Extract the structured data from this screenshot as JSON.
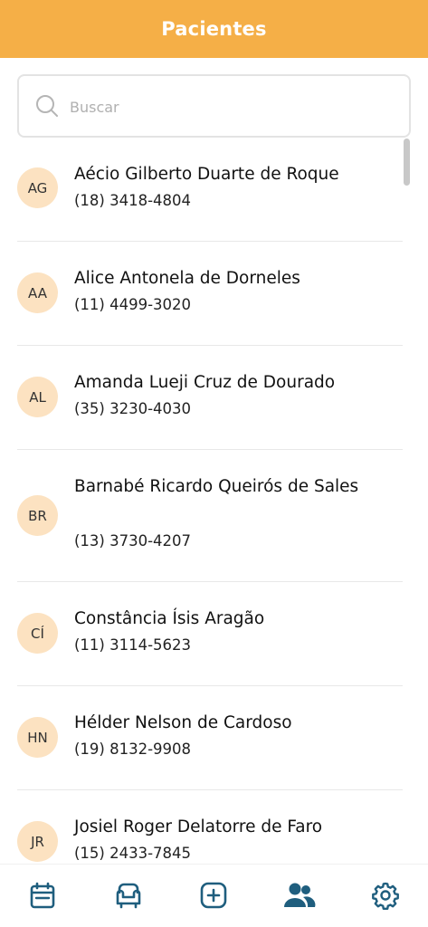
{
  "header": {
    "title": "Pacientes"
  },
  "search": {
    "placeholder": "Buscar"
  },
  "patients": [
    {
      "initials": "AG",
      "name": "Aécio Gilberto Duarte de Roque",
      "phone": "(18) 3418-4804"
    },
    {
      "initials": "AA",
      "name": "Alice Antonela de Dorneles",
      "phone": "(11) 4499-3020"
    },
    {
      "initials": "AL",
      "name": "Amanda Lueji Cruz de Dourado",
      "phone": "(35) 3230-4030"
    },
    {
      "initials": "BR",
      "name": "Barnabé Ricardo Queirós de Sales",
      "phone": "(13) 3730-4207"
    },
    {
      "initials": "CÍ",
      "name": "Constância Ísis Aragão",
      "phone": "(11) 3114-5623"
    },
    {
      "initials": "HN",
      "name": "Hélder Nelson de Cardoso",
      "phone": "(19) 8132-9908"
    },
    {
      "initials": "JR",
      "name": "Josiel Roger Delatorre de Faro",
      "phone": "(15) 2433-7845"
    }
  ],
  "bottom_nav": {
    "items": [
      {
        "icon": "calendar-icon",
        "active": false
      },
      {
        "icon": "armchair-icon",
        "active": false
      },
      {
        "icon": "add-square-icon",
        "active": false
      },
      {
        "icon": "users-icon",
        "active": true
      },
      {
        "icon": "gear-icon",
        "active": false
      }
    ],
    "color": "#1F5E7E"
  },
  "colors": {
    "header": "#F5AF47",
    "avatar_bg": "#FCE2C1",
    "nav_icon": "#1F5E7E"
  }
}
